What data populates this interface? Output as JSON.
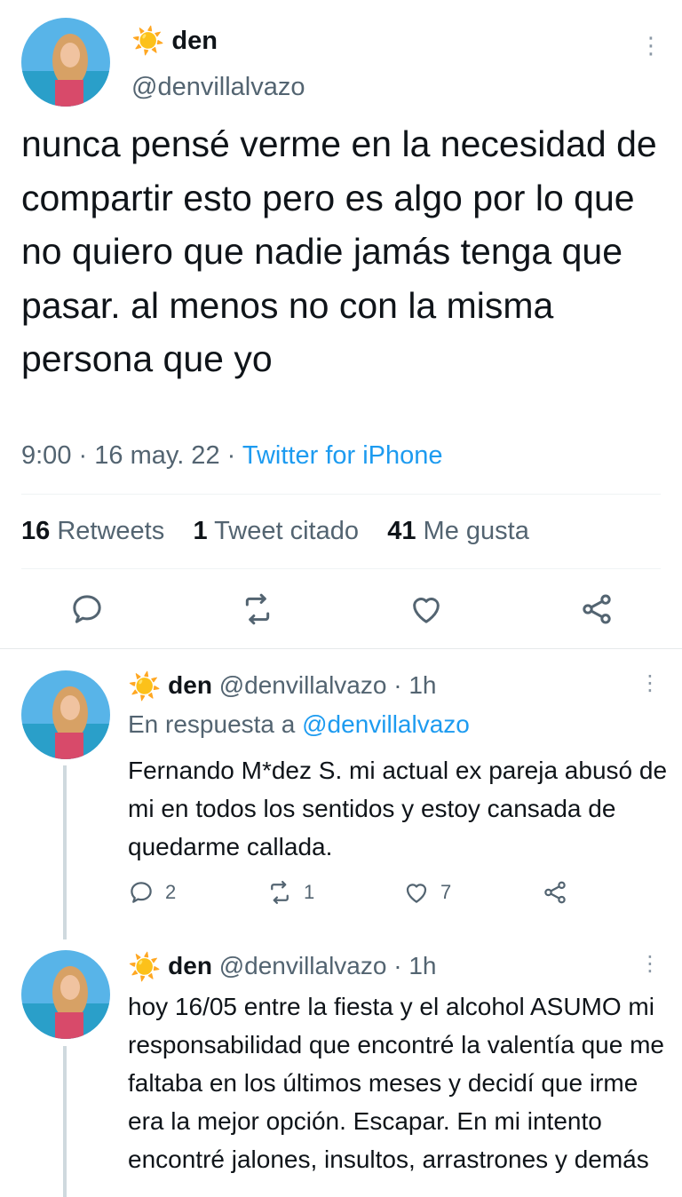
{
  "main_tweet": {
    "emoji": "☀️",
    "name": "den",
    "handle": "@denvillalvazo",
    "text": "nunca pensé verme en la necesidad de compartir esto pero es algo por lo que no quiero que nadie jamás tenga que pasar. al menos no con la misma persona que yo",
    "time": "9:00",
    "date": "16 may. 22",
    "source": "Twitter for iPhone",
    "stats": {
      "retweets_count": "16",
      "retweets_label": "Retweets",
      "quotes_count": "1",
      "quotes_label": "Tweet citado",
      "likes_count": "41",
      "likes_label": "Me gusta"
    }
  },
  "reply1": {
    "emoji": "☀️",
    "name": "den",
    "handle": "@denvillalvazo",
    "age": "1h",
    "reply_prefix": "En respuesta a",
    "reply_handle": "@denvillalvazo",
    "text": "Fernando M*dez S. mi actual ex pareja abusó de mi en todos los sentidos y estoy cansada de quedarme callada.",
    "replies": "2",
    "retweets": "1",
    "likes": "7"
  },
  "reply2": {
    "emoji": "☀️",
    "name": "den",
    "handle": "@denvillalvazo",
    "age": "1h",
    "text": "hoy 16/05 entre la fiesta y el alcohol ASUMO mi responsabilidad que encontré la valentía que me faltaba en los últimos meses y decidí que irme era la mejor opción. Escapar. En mi intento encontré jalones, insultos, arrastrones y demás"
  },
  "separators": {
    "dot": "·",
    "more": "⋮"
  },
  "colors": {
    "link": "#1d9bf0",
    "secondary": "#536471",
    "sun": "#f5b400"
  }
}
